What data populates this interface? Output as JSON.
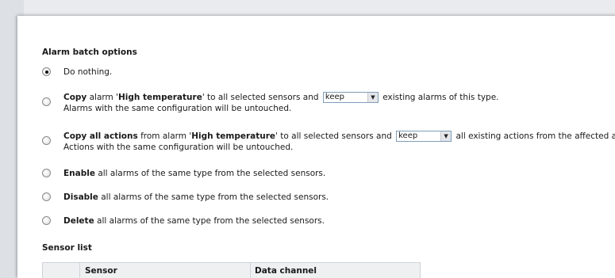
{
  "alarm_options": {
    "title": "Alarm batch options",
    "opt1": {
      "text": "Do nothing."
    },
    "opt2": {
      "bold1": "Copy",
      "t1": " alarm '",
      "bold2": "High temperature",
      "t2": "' to all selected sensors and ",
      "select": "keep",
      "t3": " existing alarms of this type.",
      "sub": "Alarms with the same configuration will be untouched."
    },
    "opt3": {
      "bold1": "Copy all actions",
      "t1": " from alarm '",
      "bold2": "High temperature",
      "t2": "' to all selected sensors and ",
      "select": "keep",
      "t3": " all existing actions from the affected alarms.",
      "sub": "Actions with the same configuration will be untouched."
    },
    "opt4": {
      "bold": "Enable",
      "rest": " all alarms of the same type from the selected sensors."
    },
    "opt5": {
      "bold": "Disable",
      "rest": " all alarms of the same type from the selected sensors."
    },
    "opt6": {
      "bold": "Delete",
      "rest": " all alarms of the same type from the selected sensors."
    }
  },
  "sensor_list": {
    "title": "Sensor list",
    "col_sensor": "Sensor",
    "col_channel": "Data channel"
  }
}
